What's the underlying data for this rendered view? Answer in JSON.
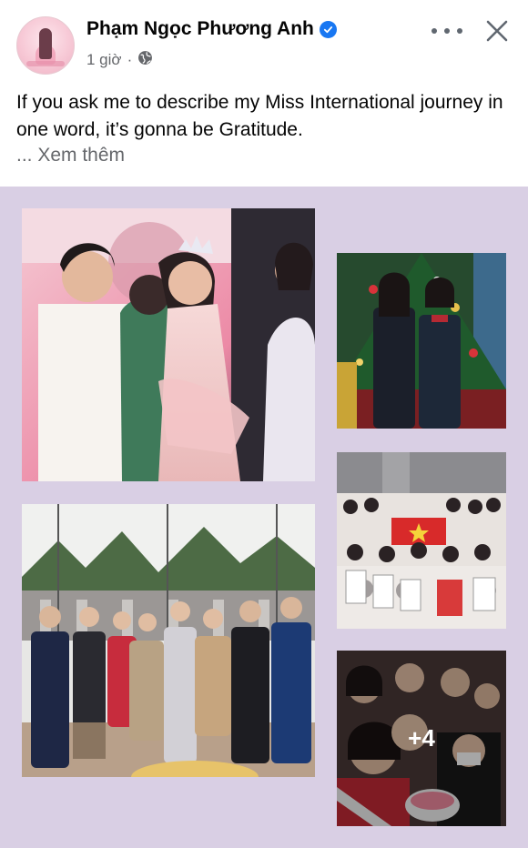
{
  "post": {
    "author": "Phạm Ngọc Phương Anh",
    "time": "1 giờ",
    "separator": "·",
    "text": "If you ask me to describe my Miss International journey in one word, it’s gonna be Gratitude.",
    "see_more": "... Xem thêm"
  },
  "gallery": {
    "more_count": "+4",
    "photos": [
      "photo-stage-crowning",
      "photo-christmas-tree",
      "photo-fan-meeting",
      "photo-group-visit",
      "photo-fans-selfie"
    ]
  },
  "colors": {
    "verified": "#1877f2",
    "gallery_background": "#d9cfe4",
    "muted_text": "#65676b"
  },
  "icons": [
    "verified-badge-icon",
    "globe-icon",
    "more-options-icon",
    "close-icon"
  ]
}
